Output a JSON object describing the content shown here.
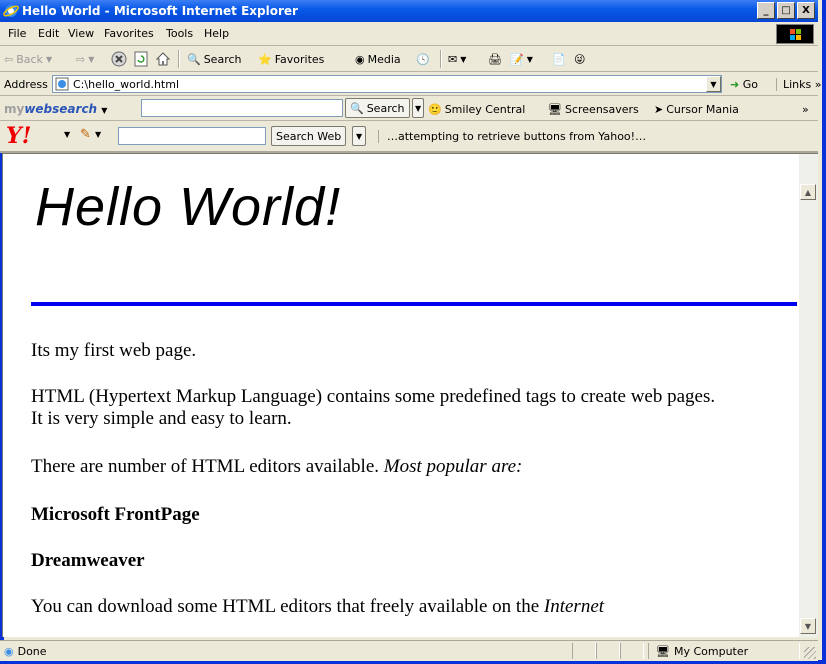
{
  "window": {
    "title": "Hello World - Microsoft Internet Explorer",
    "controls": [
      "_",
      "□",
      "X"
    ]
  },
  "menu": [
    "File",
    "Edit",
    "View",
    "Favorites",
    "Tools",
    "Help"
  ],
  "toolbar": {
    "back": "Back",
    "search": "Search",
    "favorites": "Favorites",
    "media": "Media"
  },
  "address": {
    "label": "Address",
    "value": "C:\\hello_world.html",
    "go": "Go",
    "links": "Links"
  },
  "mywebsearch": {
    "logo_prefix": "my",
    "logo_main": "websearch",
    "search_button": "Search",
    "smiley": "Smiley Central",
    "screensavers": "Screensavers",
    "cursor": "Cursor Mania"
  },
  "yahoo": {
    "logo": "Y!",
    "search_button": "Search Web",
    "status": "…attempting to retrieve buttons from Yahoo!…"
  },
  "page": {
    "heading": "Hello World!",
    "p1": "Its my first web page.",
    "p2_line1": "HTML (Hypertext Markup Language) contains some predefined tags to create web pages.",
    "p2_line2": "It is very simple and easy to learn.",
    "p3_text": "There are number of HTML editors available. ",
    "p3_em": "Most popular are:",
    "editor1": "Microsoft FrontPage",
    "editor2": "Dreamweaver",
    "p4_text": "You can download some HTML editors that freely available on the ",
    "p4_em": "Internet"
  },
  "status": {
    "text": "Done",
    "zone": "My Computer"
  },
  "colors": {
    "titlebar": "#0a5ae8",
    "rule": "#0000ee",
    "chrome": "#ece9d8"
  }
}
